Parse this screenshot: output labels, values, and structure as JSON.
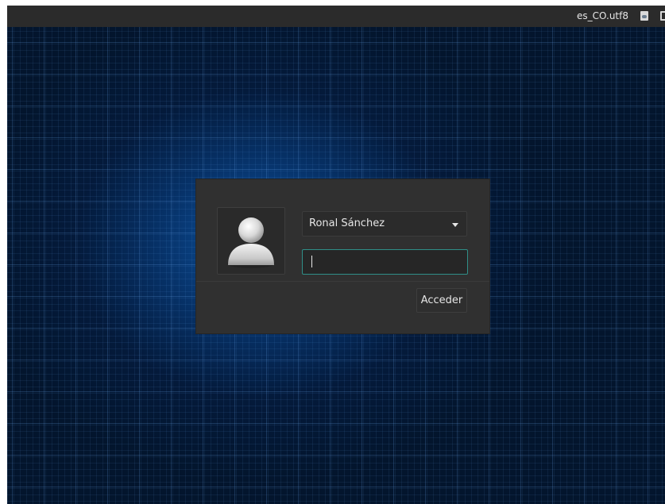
{
  "top_panel": {
    "locale": "es_CO.utf8",
    "indicators": [
      "document-icon",
      "power-icon"
    ]
  },
  "login": {
    "selected_user": "Ronal Sánchez",
    "password_value": "",
    "submit_label": "Acceder"
  },
  "colors": {
    "panel": "#2b2b2b",
    "login_box": "#303030",
    "focus_border": "#2f8f88",
    "background_dark": "#03152d",
    "background_glow": "#0c58aa"
  }
}
